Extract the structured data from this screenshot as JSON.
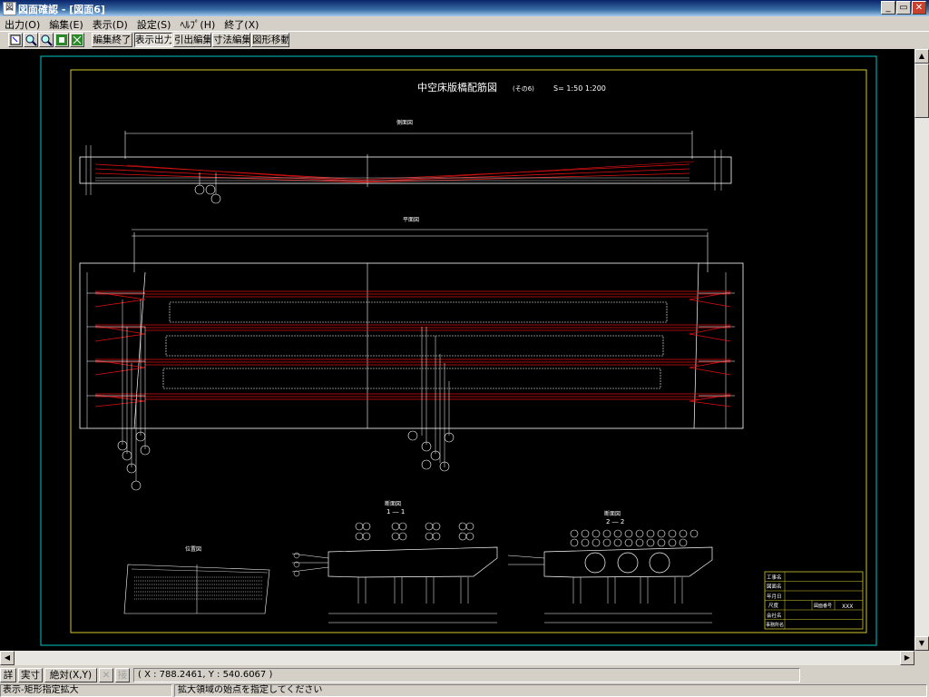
{
  "window": {
    "title": "図面確認 - [図面6]",
    "minimize": "_",
    "restore": "▭",
    "close": "✕"
  },
  "menu": [
    "出力(O)",
    "編集(E)",
    "表示(D)",
    "設定(S)",
    "ﾍﾙﾌﾟ(H)",
    "終了(X)"
  ],
  "toolbar": {
    "icons": [
      "select-icon",
      "zoom-in-icon",
      "zoom-out-icon",
      "fit-window-icon",
      "fit-all-icon"
    ],
    "buttons": [
      "編集終了",
      "表示出力",
      "引出編集",
      "寸法編集",
      "図形移動"
    ]
  },
  "drawing": {
    "title": "中空床版橋配筋図",
    "subtitle": "(その6)",
    "scale": "S= 1:50  1:200",
    "side_view_label": "側面図",
    "plan_view_label": "平面図",
    "section1_label": "断面図",
    "section1_sub": "1 ― 1",
    "section2_label": "断面図",
    "section2_sub": "2 ― 2",
    "location_label": "位置図",
    "title_block": {
      "rows": [
        "工事名",
        "図面名",
        "年月日",
        "尺度",
        "会社名",
        "事務所名"
      ],
      "drawing_no_label": "図面番号",
      "drawing_no_value": "XXX"
    },
    "colors": {
      "frame_outer": "#00c8c8",
      "frame_inner": "#d4c832",
      "rebar": "#e01010",
      "lines": "#ffffff"
    }
  },
  "status": {
    "detail_btn": "詳",
    "actual_btn": "実寸",
    "absolute_btn": "絶対(X,Y)",
    "disabled_btn1": "✕",
    "disabled_btn2": "接",
    "coords": "( X : 788.2461, Y : 540.6067 )",
    "mode": "表示-矩形指定拡大",
    "prompt": "拡大領域の始点を指定してください"
  }
}
